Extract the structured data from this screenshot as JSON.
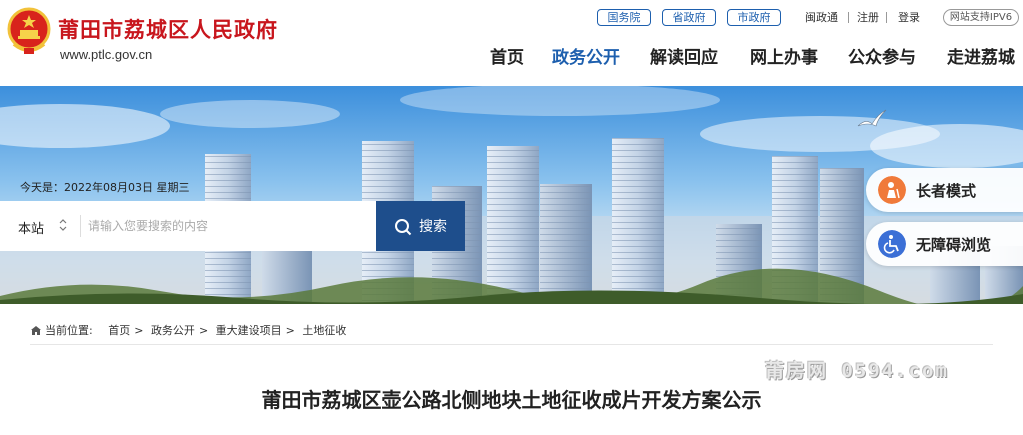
{
  "header": {
    "title": "莆田市荔城区人民政府",
    "domain": "www.ptlc.gov.cn"
  },
  "toplinks": {
    "gov": [
      "国务院",
      "省政府",
      "市政府"
    ],
    "util": [
      "闽政通",
      "注册",
      "登录"
    ],
    "ipv6": "网站支持IPV6"
  },
  "nav": {
    "items": [
      "首页",
      "政务公开",
      "解读回应",
      "网上办事",
      "公众参与",
      "走进荔城"
    ],
    "active": "政务公开"
  },
  "banner": {
    "date": "今天是：2022年08月03日 星期三",
    "search": {
      "scope": "本站",
      "placeholder": "请输入您要搜索的内容",
      "button": "搜索"
    },
    "side": {
      "elder": "长者模式",
      "accessible": "无障碍浏览"
    }
  },
  "breadcrumb": {
    "label": "当前位置:",
    "items": [
      "首页",
      "政务公开",
      "重大建设项目",
      "土地征收"
    ]
  },
  "watermark": "莆房网 0594.com",
  "article": {
    "title": "莆田市荔城区壶公路北侧地块土地征收成片开发方案公示"
  },
  "colors": {
    "brand_red": "#c8161d",
    "brand_blue": "#1d5fae",
    "search_blue": "#1e4e8c",
    "elder_orange": "#f07a3a",
    "access_blue": "#3b6fd6"
  }
}
